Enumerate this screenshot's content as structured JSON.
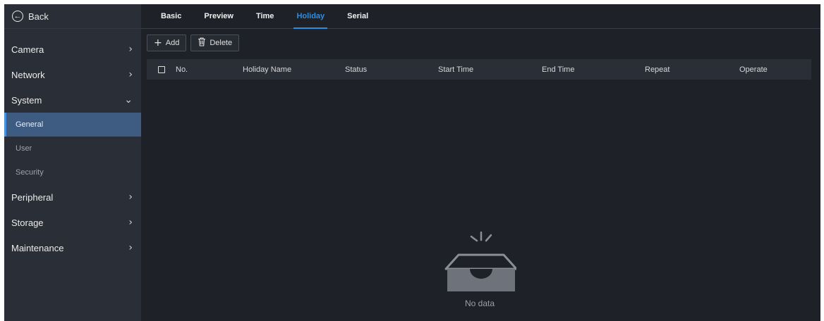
{
  "sidebar": {
    "back_label": "Back",
    "items": [
      {
        "label": "Camera",
        "chevron": "›"
      },
      {
        "label": "Network",
        "chevron": "›"
      },
      {
        "label": "System",
        "chevron": "⌄"
      },
      {
        "label": "General"
      },
      {
        "label": "User"
      },
      {
        "label": "Security"
      },
      {
        "label": "Peripheral",
        "chevron": "›"
      },
      {
        "label": "Storage",
        "chevron": "›"
      },
      {
        "label": "Maintenance",
        "chevron": "›"
      }
    ]
  },
  "tabs": [
    "Basic",
    "Preview",
    "Time",
    "Holiday",
    "Serial"
  ],
  "active_tab": "Holiday",
  "toolbar": {
    "add_label": "Add",
    "delete_label": "Delete"
  },
  "table": {
    "columns": [
      "No.",
      "Holiday Name",
      "Status",
      "Start Time",
      "End Time",
      "Repeat",
      "Operate"
    ],
    "rows": []
  },
  "empty_state": {
    "text": "No data",
    "icon": "empty-inbox-icon"
  },
  "colors": {
    "accent": "#2f8de0",
    "active_item_bg": "#3e5b82",
    "background": "#1e2127",
    "sidebar_bg": "#2a2e36"
  }
}
